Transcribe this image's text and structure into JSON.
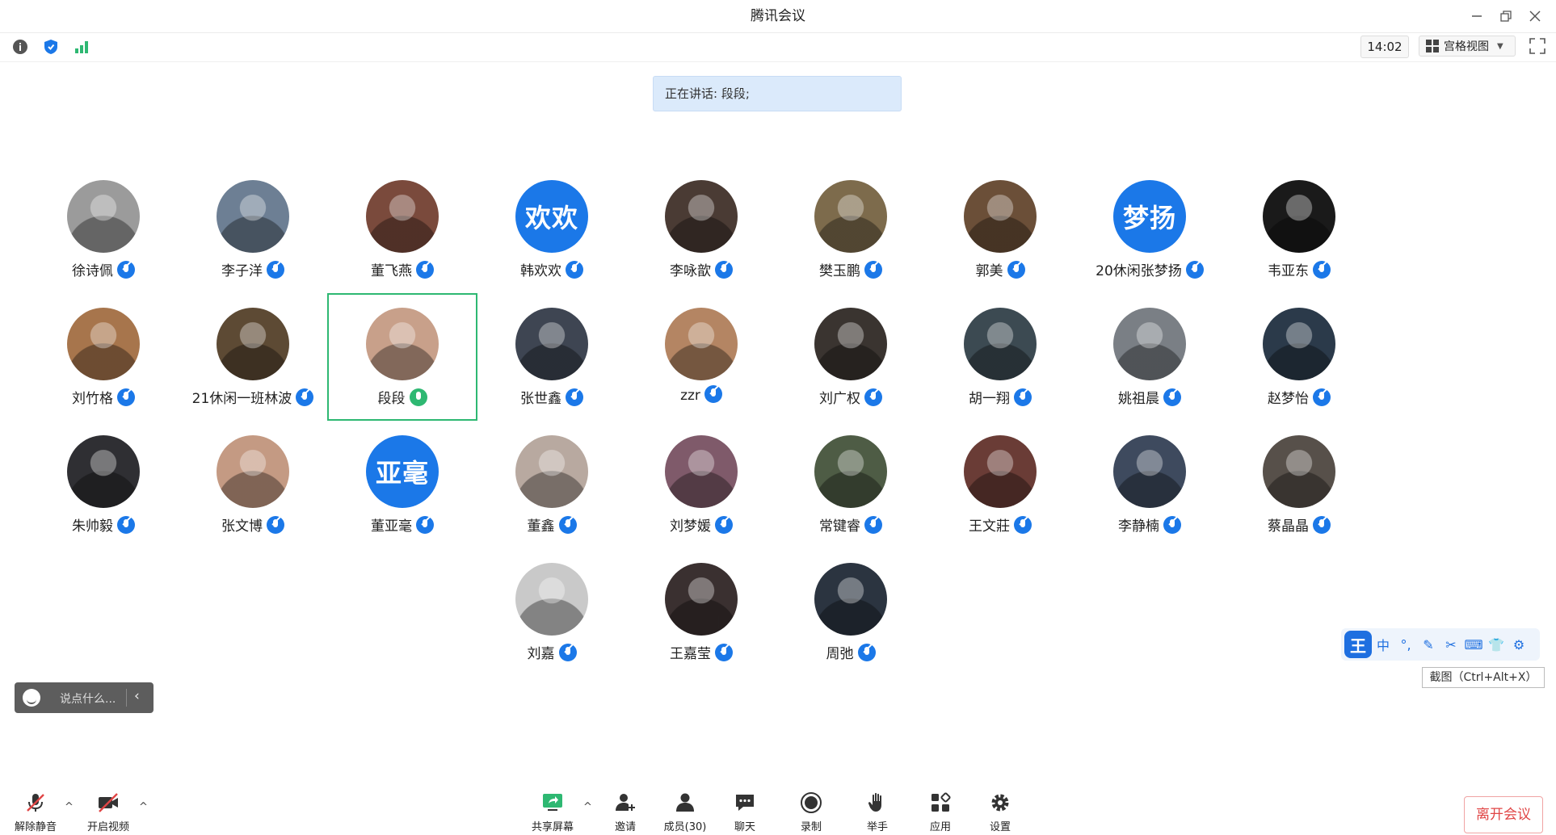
{
  "window": {
    "title": "腾讯会议",
    "minimize_icon": "minimize-icon",
    "restore_icon": "restore-icon",
    "close_icon": "close-icon"
  },
  "toolbar": {
    "time": "14:02",
    "view_label": "宫格视图",
    "colors": {
      "info": "#555555",
      "shield": "#1b78e8",
      "signal": "#2eb872"
    }
  },
  "speaking": {
    "text": "正在讲话: 段段;"
  },
  "participants": [
    {
      "name": "徐诗佩",
      "avatar_text": "",
      "color": "#9b9b9b",
      "mic": "muted"
    },
    {
      "name": "李子洋",
      "avatar_text": "",
      "color": "#6d7f94",
      "mic": "muted"
    },
    {
      "name": "董飞燕",
      "avatar_text": "",
      "color": "#7a4a3c",
      "mic": "muted"
    },
    {
      "name": "韩欢欢",
      "avatar_text": "欢欢",
      "color": "#1b78e8",
      "mic": "muted"
    },
    {
      "name": "李咏歆",
      "avatar_text": "",
      "color": "#4a3b34",
      "mic": "muted"
    },
    {
      "name": "樊玉鹏",
      "avatar_text": "",
      "color": "#7d6b4c",
      "mic": "muted"
    },
    {
      "name": "郭美",
      "avatar_text": "",
      "color": "#6b4f38",
      "mic": "muted"
    },
    {
      "name": "20休闲张梦扬",
      "avatar_text": "梦扬",
      "color": "#1b78e8",
      "mic": "muted"
    },
    {
      "name": "韦亚东",
      "avatar_text": "",
      "color": "#1a1a1a",
      "mic": "muted"
    },
    {
      "name": "刘竹格",
      "avatar_text": "",
      "color": "#a7754c",
      "mic": "muted"
    },
    {
      "name": "21休闲一班林波",
      "avatar_text": "",
      "color": "#5d4a34",
      "mic": "muted"
    },
    {
      "name": "段段",
      "avatar_text": "",
      "color": "#c8a08a",
      "mic": "talking",
      "active": true
    },
    {
      "name": "张世鑫",
      "avatar_text": "",
      "color": "#3e4552",
      "mic": "muted"
    },
    {
      "name": "zzr",
      "avatar_text": "",
      "color": "#b48563",
      "mic": "muted"
    },
    {
      "name": "刘广权",
      "avatar_text": "",
      "color": "#3a3430",
      "mic": "muted"
    },
    {
      "name": "胡一翔",
      "avatar_text": "",
      "color": "#3c4a52",
      "mic": "muted"
    },
    {
      "name": "姚祖晨",
      "avatar_text": "",
      "color": "#7a7f85",
      "mic": "muted"
    },
    {
      "name": "赵梦怡",
      "avatar_text": "",
      "color": "#2b3a4a",
      "mic": "muted"
    },
    {
      "name": "朱帅毅",
      "avatar_text": "",
      "color": "#2f2f33",
      "mic": "muted"
    },
    {
      "name": "张文博",
      "avatar_text": "",
      "color": "#c49a83",
      "mic": "muted"
    },
    {
      "name": "董亚毫",
      "avatar_text": "亚毫",
      "color": "#1b78e8",
      "mic": "muted"
    },
    {
      "name": "董鑫",
      "avatar_text": "",
      "color": "#b8a9a0",
      "mic": "muted"
    },
    {
      "name": "刘梦媛",
      "avatar_text": "",
      "color": "#7f5a6a",
      "mic": "muted"
    },
    {
      "name": "常键睿",
      "avatar_text": "",
      "color": "#4e5c45",
      "mic": "muted"
    },
    {
      "name": "王文莊",
      "avatar_text": "",
      "color": "#6a3c36",
      "mic": "muted"
    },
    {
      "name": "李静楠",
      "avatar_text": "",
      "color": "#3e4a5e",
      "mic": "muted"
    },
    {
      "name": "蔡晶晶",
      "avatar_text": "",
      "color": "#57504a",
      "mic": "muted"
    },
    {
      "name": "刘嘉",
      "avatar_text": "",
      "color": "#c9c9c9",
      "mic": "muted"
    },
    {
      "name": "王嘉莹",
      "avatar_text": "",
      "color": "#3a3030",
      "mic": "muted"
    },
    {
      "name": "周弛",
      "avatar_text": "",
      "color": "#2b3440",
      "mic": "muted"
    }
  ],
  "chat": {
    "placeholder": "说点什么..."
  },
  "ime": {
    "logo": "王",
    "items": [
      "中",
      "°,",
      "✎",
      "✂",
      "⌨",
      "👕",
      "⚙"
    ],
    "tooltip": "截图（Ctrl+Alt+X）"
  },
  "bottom": {
    "unmute": "解除静音",
    "video": "开启视频",
    "share": "共享屏幕",
    "invite": "邀请",
    "members": "成员(30)",
    "chat": "聊天",
    "record": "录制",
    "raise": "举手",
    "apps": "应用",
    "settings": "设置",
    "leave": "离开会议"
  }
}
